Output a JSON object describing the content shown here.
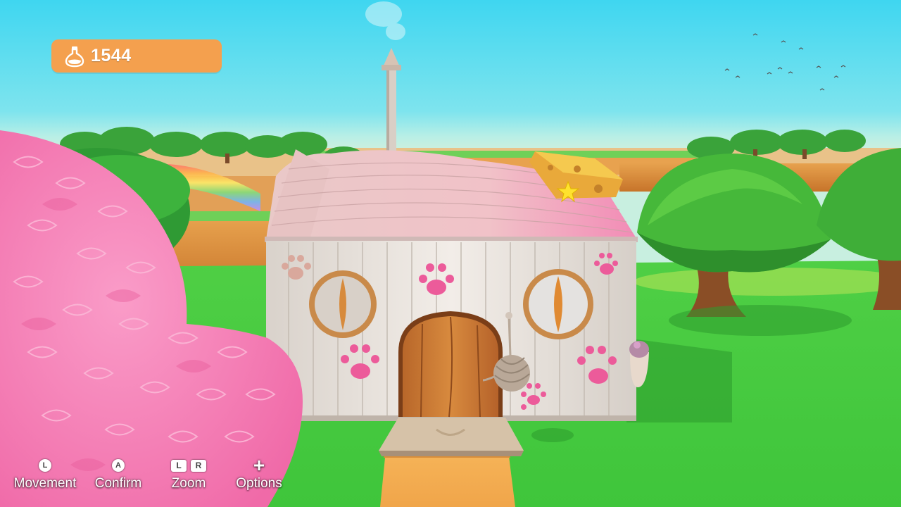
{
  "hud": {
    "currency": {
      "icon": "potion-flask-icon",
      "value": "1544",
      "color": "#f4a04e"
    }
  },
  "controls": [
    {
      "name": "movement",
      "glyphs": [
        "L"
      ],
      "glyph_style": "circle",
      "label": "Movement"
    },
    {
      "name": "confirm",
      "glyphs": [
        "A"
      ],
      "glyph_style": "circle",
      "label": "Confirm"
    },
    {
      "name": "zoom",
      "glyphs": [
        "L",
        "R"
      ],
      "glyph_style": "rect",
      "label": "Zoom"
    },
    {
      "name": "options",
      "glyphs": [
        "+"
      ],
      "glyph_style": "plus",
      "label": "Options"
    }
  ],
  "colors": {
    "sky_top": "#3fd6f0",
    "grass": "#57d94a",
    "house_wall": "#ece6e0",
    "roof": "#f2b8c4",
    "paw_print": "#ec5b9a",
    "door": "#c67a33",
    "bush": "#f77fb6",
    "tree_leaves": "#46b83a"
  }
}
